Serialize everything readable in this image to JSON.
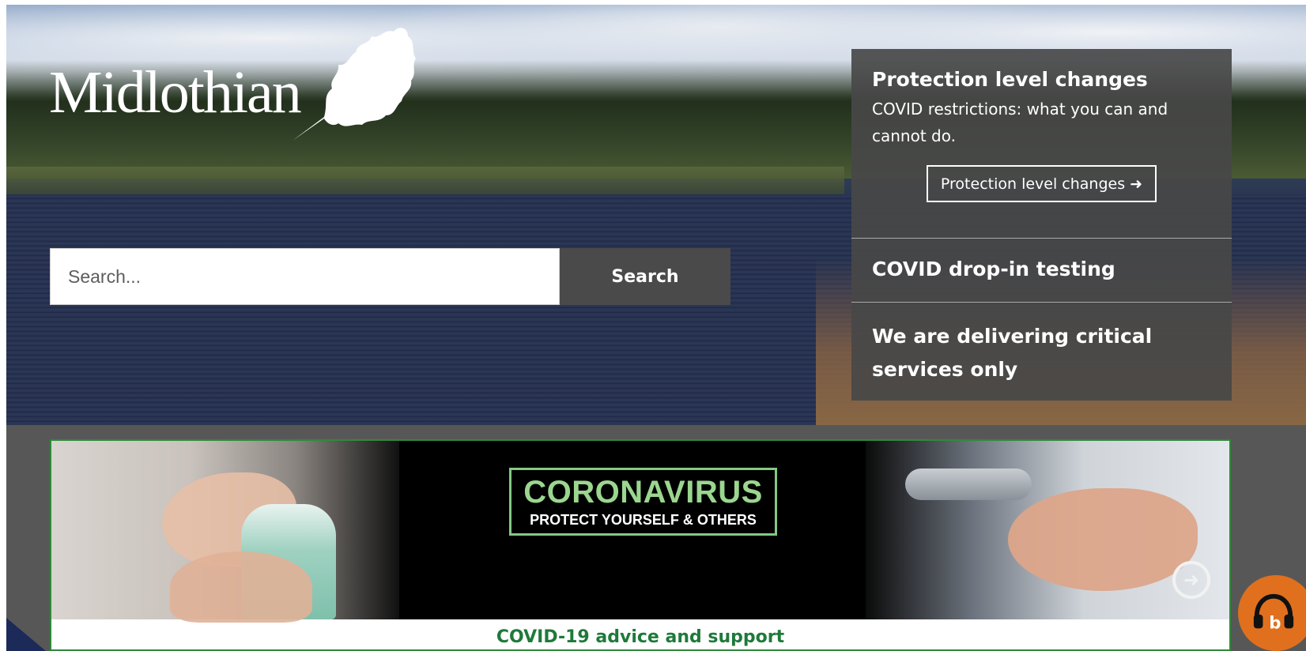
{
  "brand": {
    "name": "Midlothian",
    "leaf_icon": "oak-leaf-icon"
  },
  "search": {
    "placeholder": "Search...",
    "button_label": "Search"
  },
  "panel": {
    "items": [
      {
        "title": "Protection level changes",
        "text": "COVID restrictions: what you can and cannot do.",
        "button_label": "Protection level changes ➜"
      },
      {
        "title": "COVID drop-in testing"
      },
      {
        "title": "We are delivering critical services only"
      }
    ]
  },
  "covid_banner": {
    "logo_big": "CORONAVIRUS",
    "logo_small": "PROTECT YOURSELF & OTHERS",
    "caption": "COVID-19 advice and support",
    "arrow_icon": "arrow-right-circle-icon"
  },
  "colors": {
    "accent_green": "#1e7a3a",
    "panel_bg": "#484848",
    "audio_orange": "#e0701d",
    "covid_logo_green": "#9bd68f"
  },
  "audio_widget": {
    "icon": "headphones-icon"
  }
}
